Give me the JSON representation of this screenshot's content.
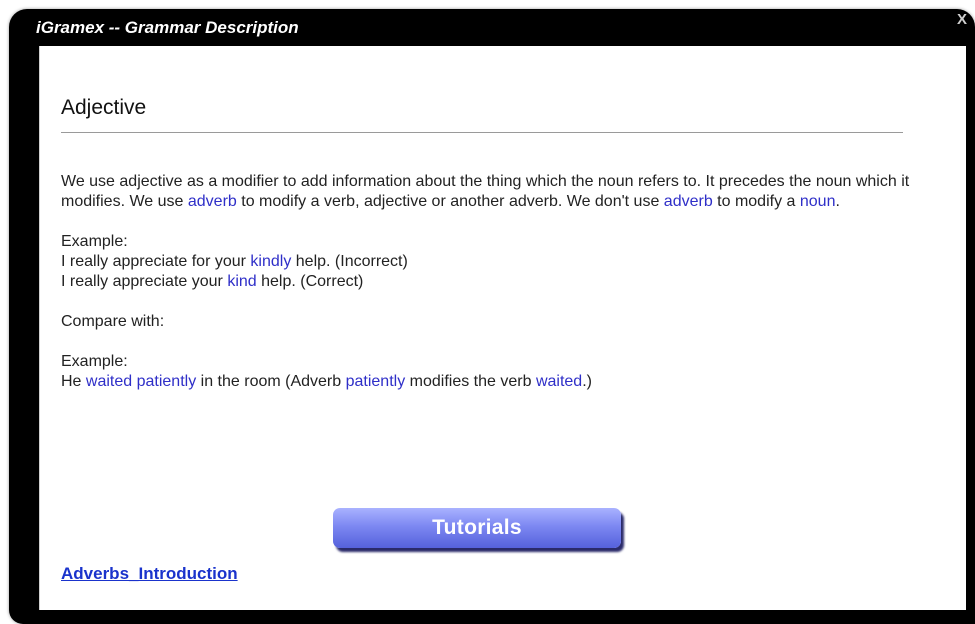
{
  "window": {
    "title": "iGramex -- Grammar Description",
    "close_label": "X"
  },
  "content": {
    "heading": "Adjective",
    "paragraph1": {
      "t1": "We use adjective as a modifier to add information about the thing which the noun refers to. It precedes the noun which it modifies. We use ",
      "k1": "adverb",
      "t2": " to modify a verb, adjective or another adverb. We don't use ",
      "k2": "adverb",
      "t3": " to modify a ",
      "k3": "noun",
      "t4": "."
    },
    "example1": {
      "label": "Example:",
      "line1": {
        "a": "I really appreciate for your ",
        "k": "kindly",
        "b": " help. (Incorrect)"
      },
      "line2": {
        "a": "I really appreciate your ",
        "k": "kind",
        "b": " help. (Correct)"
      }
    },
    "compare_label": "Compare with:",
    "example2": {
      "label": "Example:",
      "line": {
        "a": "He ",
        "k1": "waited patiently",
        "b": " in the room (Adverb ",
        "k2": "patiently",
        "c": " modifies the verb ",
        "k3": "waited",
        "d": ".)"
      }
    },
    "tutorials_button": "Tutorials",
    "link_text": "Adverbs_Introduction"
  },
  "colors": {
    "frame": "#000000",
    "keyword": "#2f2fc8",
    "link": "#1a33cc",
    "button": "#7d88f2"
  }
}
